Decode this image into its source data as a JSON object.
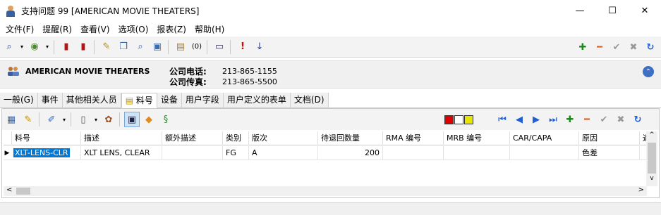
{
  "window": {
    "title": "支持问题 99 [AMERICAN MOVIE THEATERS]",
    "minimize": "—",
    "maximize": "☐",
    "close": "✕"
  },
  "menu": [
    "文件(F)",
    "提醒(R)",
    "查看(V)",
    "选项(O)",
    "报表(Z)",
    "帮助(H)"
  ],
  "toolbar": {
    "attachment_count": "(0)"
  },
  "header": {
    "company": "AMERICAN MOVIE THEATERS",
    "phone_label": "公司电话:",
    "phone": "213-865-1155",
    "fax_label": "公司传真:",
    "fax": "213-865-5500"
  },
  "tabs": [
    "一般(G)",
    "事件",
    "其他相关人员",
    "料号",
    "设备",
    "用户字段",
    "用户定义的表单",
    "文档(D)"
  ],
  "active_tab": "料号",
  "indicator_colors": [
    "#e00000",
    "#ffffff",
    "#e6e600"
  ],
  "grid": {
    "columns": [
      "料号",
      "描述",
      "额外描述",
      "类别",
      "版次",
      "待退回数量",
      "RMA 编号",
      "MRB 编号",
      "CAR/CAPA",
      "原因",
      "返"
    ],
    "rows": [
      [
        "XLT-LENS-CLR",
        "XLT LENS, CLEAR",
        "",
        "FG",
        "A",
        "200",
        "",
        "",
        "",
        "色差",
        ""
      ]
    ]
  },
  "colors": {
    "accent": "#0078d7",
    "add": "#1a8a1a",
    "remove": "#e06020",
    "nav": "#1f5fd6"
  }
}
